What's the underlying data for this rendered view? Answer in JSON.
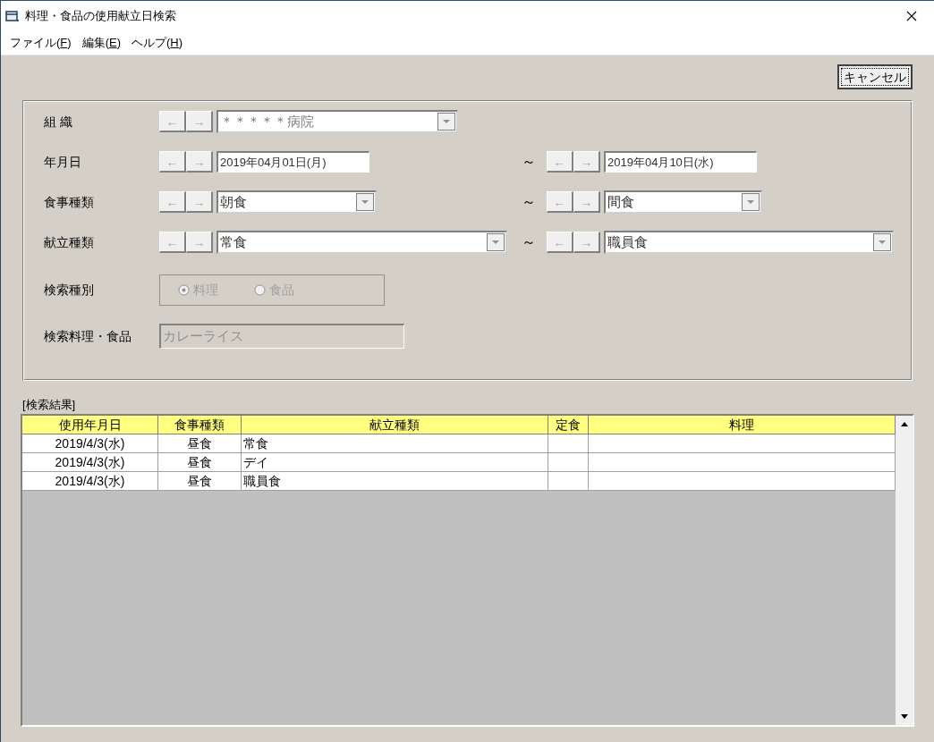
{
  "window": {
    "title": "料理・食品の使用献立日検索"
  },
  "menu": [
    {
      "label": "ファイル(",
      "key": "F",
      "end": ")"
    },
    {
      "label": "編集(",
      "key": "E",
      "end": ")"
    },
    {
      "label": "ヘルプ(",
      "key": "H",
      "end": ")"
    }
  ],
  "cancel_button": "キャンセル",
  "form_rows": [
    {
      "label": "組 織",
      "from": {
        "kind": "combo",
        "value": "＊＊＊＊＊病院",
        "disabled": true
      },
      "tilde": null,
      "to": null
    },
    {
      "label": "年月日",
      "from": {
        "kind": "date",
        "value": "2019年04月01日(月)"
      },
      "tilde": "～",
      "to": {
        "kind": "date",
        "value": "2019年04月10日(水)"
      }
    },
    {
      "label": "食事種類",
      "from": {
        "kind": "combo",
        "value": "朝食",
        "disabled": false
      },
      "tilde": "～",
      "to": {
        "kind": "combo",
        "value": "間食",
        "disabled": false
      }
    },
    {
      "label": "献立種類",
      "from": {
        "kind": "combo",
        "value": "常食",
        "disabled": false
      },
      "tilde": "～",
      "to": {
        "kind": "combo",
        "value": "職員食",
        "disabled": false
      }
    }
  ],
  "arrows": {
    "prev": "←",
    "next": "→"
  },
  "search_type": {
    "label": "検索種別",
    "disabled": true,
    "options": [
      {
        "label": "料理",
        "selected": true
      },
      {
        "label": "食品",
        "selected": false
      }
    ]
  },
  "search_item": {
    "label": "検索料理・食品",
    "value": "カレーライス",
    "disabled": true
  },
  "results": {
    "label": "[検索結果]",
    "columns": [
      "使用年月日",
      "食事種類",
      "献立種類",
      "定食",
      "料理"
    ],
    "rows": [
      [
        "2019/4/3(水)",
        "昼食",
        "常食",
        "",
        ""
      ],
      [
        "2019/4/3(水)",
        "昼食",
        "デイ",
        "",
        ""
      ],
      [
        "2019/4/3(水)",
        "昼食",
        "職員食",
        "",
        ""
      ]
    ]
  }
}
